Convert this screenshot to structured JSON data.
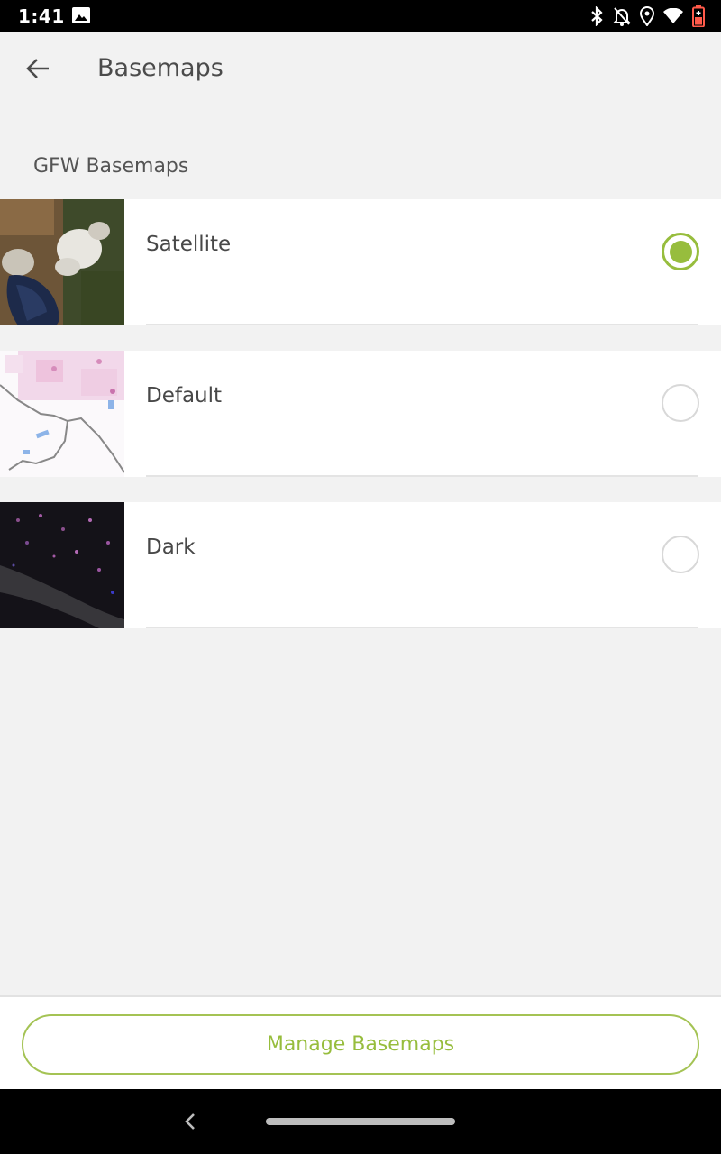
{
  "status_bar": {
    "time": "1:41",
    "icons": [
      "image-icon",
      "bluetooth-icon",
      "notifications-off-icon",
      "location-icon",
      "wifi-icon",
      "battery-icon"
    ]
  },
  "app_bar": {
    "back_icon": "arrow-back-icon",
    "title": "Basemaps"
  },
  "section": {
    "title": "GFW Basemaps"
  },
  "basemaps": [
    {
      "label": "Satellite",
      "selected": true
    },
    {
      "label": "Default",
      "selected": false
    },
    {
      "label": "Dark",
      "selected": false
    }
  ],
  "bottom": {
    "manage_label": "Manage Basemaps"
  },
  "colors": {
    "accent": "#97bd3d",
    "background": "#f2f2f2",
    "surface": "#ffffff"
  },
  "nav_bar": {
    "back_icon": "nav-back-icon",
    "home_icon": "home-pill-icon"
  }
}
